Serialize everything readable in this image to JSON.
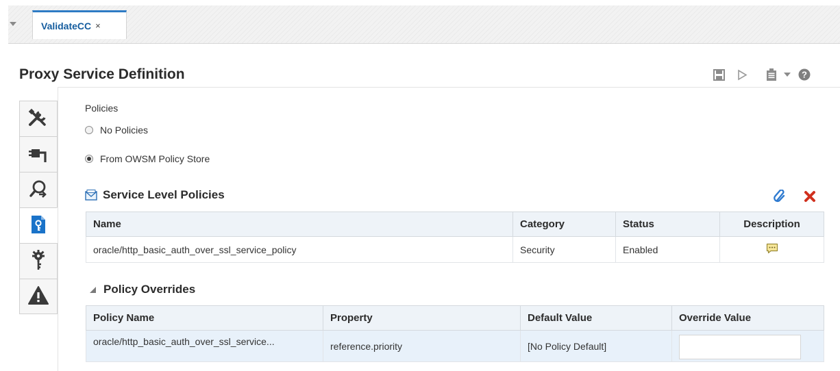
{
  "tabs": [
    {
      "label": "ValidateCC",
      "close_glyph": "×",
      "active": true
    }
  ],
  "page": {
    "title": "Proxy Service Definition"
  },
  "toolbar": {
    "icons": [
      "save-icon",
      "run-icon",
      "clipboard-icon",
      "dropdown-icon",
      "help-icon"
    ]
  },
  "sidebar": {
    "items": [
      {
        "icon": "tools-icon"
      },
      {
        "icon": "plug-icon"
      },
      {
        "icon": "search-service-icon"
      },
      {
        "icon": "policy-document-icon",
        "active": true
      },
      {
        "icon": "gear-key-icon"
      },
      {
        "icon": "warning-icon"
      }
    ]
  },
  "policies": {
    "label": "Policies",
    "options": [
      {
        "label": "No Policies",
        "checked": false
      },
      {
        "label": "From OWSM Policy Store",
        "checked": true
      }
    ]
  },
  "service_level_policies": {
    "title": "Service Level Policies",
    "columns": [
      "Name",
      "Category",
      "Status",
      "Description"
    ],
    "rows": [
      {
        "name": "oracle/http_basic_auth_over_ssl_service_policy",
        "category": "Security",
        "status": "Enabled",
        "description_icon": "comment-icon"
      }
    ]
  },
  "policy_overrides": {
    "title": "Policy Overrides",
    "columns": [
      "Policy Name",
      "Property",
      "Default Value",
      "Override Value"
    ],
    "rows": [
      {
        "policy_name": "oracle/http_basic_auth_over_ssl_service...",
        "property": "reference.priority",
        "default_value": "[No Policy Default]",
        "override_value": ""
      }
    ]
  },
  "colors": {
    "tab_accent": "#2e7bc4",
    "active_tab_blue": "#1a73c9",
    "table_header_bg": "#eef3f8",
    "selected_row_bg": "#e8f1fa",
    "delete_red": "#d0301e"
  }
}
